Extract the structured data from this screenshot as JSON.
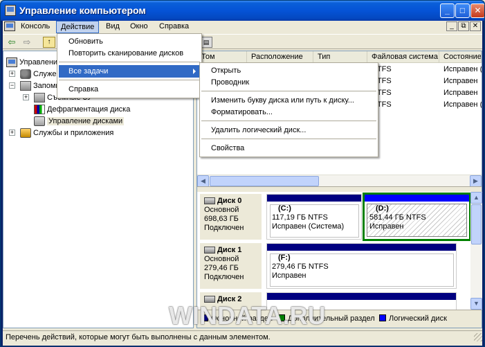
{
  "window": {
    "title": "Управление компьютером",
    "buttons": {
      "minimize": "_",
      "maximize": "□",
      "close": "✕"
    }
  },
  "menubar": {
    "items": [
      "Консоль",
      "Действие",
      "Вид",
      "Окно",
      "Справка"
    ],
    "active": "Действие",
    "mdi_buttons": [
      "_",
      "⧉",
      "✕"
    ]
  },
  "toolbar": {
    "icons": [
      "back-arrow-icon",
      "forward-arrow-icon",
      "up-folder-icon",
      "properties-icon"
    ]
  },
  "tree": {
    "root": "Управление компьютером (локальным)",
    "nodes": [
      {
        "label": "Служебные программы",
        "expander": "+"
      },
      {
        "label": "Запоминающие устройства",
        "expander": "−"
      },
      {
        "label": "Съемные ЗУ",
        "expander": "+"
      },
      {
        "label": "Дефрагментация диска"
      },
      {
        "label": "Управление дисками",
        "selected": true
      },
      {
        "label": "Службы и приложения",
        "expander": "+"
      }
    ]
  },
  "volume_list": {
    "columns": [
      "Том",
      "Расположение",
      "Тип",
      "Файловая система",
      "Состояние"
    ],
    "rows": [
      {
        "fs": "NTFS",
        "state": "Исправен (С"
      },
      {
        "fs": "NTFS",
        "state": "Исправен"
      },
      {
        "fs": "NTFS",
        "state": "Исправен"
      },
      {
        "fs": "NTFS",
        "state": "Исправен (А"
      }
    ]
  },
  "disks": [
    {
      "name": "Диск 0",
      "type": "Основной",
      "size": "698,63 ГБ",
      "status": "Подключен",
      "partitions": [
        {
          "name": "(C:)",
          "size": "117,19 ГБ NTFS",
          "status": "Исправен (Система)"
        },
        {
          "name": "(D:)",
          "size": "581,44 ГБ NTFS",
          "status": "Исправен"
        }
      ]
    },
    {
      "name": "Диск 1",
      "type": "Основной",
      "size": "279,46 ГБ",
      "status": "Подключен",
      "partitions": [
        {
          "name": "(F:)",
          "size": "279,46 ГБ NTFS",
          "status": "Исправен"
        }
      ]
    },
    {
      "name": "Диск 2"
    }
  ],
  "legend": [
    {
      "label": "Основной раздел",
      "color": "#000080"
    },
    {
      "label": "Дополнительный раздел",
      "color": "#008000"
    },
    {
      "label": "Логический диск",
      "color": "#0000ff"
    }
  ],
  "action_menu": {
    "items": [
      "Обновить",
      "Повторить сканирование дисков",
      "Все задачи",
      "Справка"
    ],
    "highlighted": "Все задачи"
  },
  "submenu": {
    "items": [
      "Открыть",
      "Проводник",
      "Изменить букву диска или путь к диску...",
      "Форматировать...",
      "Удалить логический диск...",
      "Свойства"
    ]
  },
  "statusbar": {
    "text": "Перечень действий, которые могут быть выполнены с данным элементом."
  },
  "watermark": "WINDATA.RU",
  "colors": {
    "titlebar": "#0553d6",
    "menu_highlight": "#316ac5",
    "primary_partition": "#000080",
    "logical_drive": "#0000ff",
    "extended_partition": "#008000"
  }
}
